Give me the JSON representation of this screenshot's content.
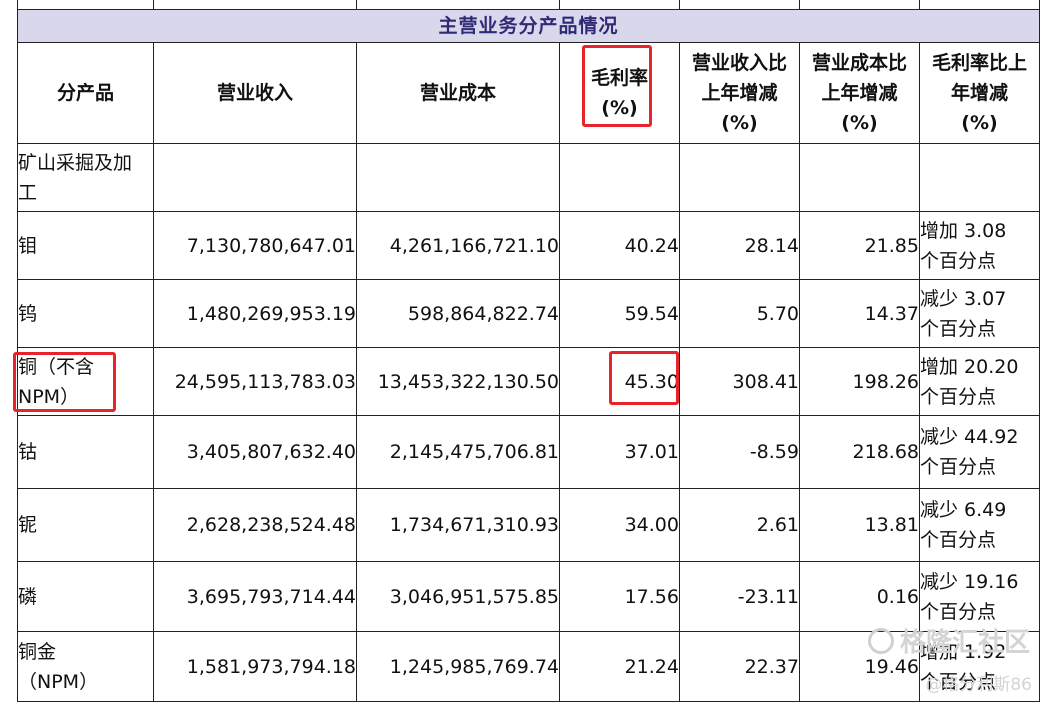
{
  "table": {
    "title": "主营业务分产品情况",
    "headers": {
      "product": "分产品",
      "revenue": "营业收入",
      "cost": "营业成本",
      "margin": [
        "毛利率",
        "(%)"
      ],
      "revenue_change": [
        "营业收入比",
        "上年增减",
        "(%)"
      ],
      "cost_change": [
        "营业成本比",
        "上年增减",
        "(%)"
      ],
      "margin_change": [
        "毛利率比上",
        "年增减",
        "(%)"
      ]
    },
    "section": [
      "矿山采掘及加",
      "工"
    ],
    "rows": [
      {
        "name": [
          "钼"
        ],
        "revenue": "7,130,780,647.01",
        "cost": "4,261,166,721.10",
        "margin": "40.24",
        "revenue_change": "28.14",
        "cost_change": "21.85",
        "margin_change": [
          "增加 3.08",
          "个百分点"
        ]
      },
      {
        "name": [
          "钨"
        ],
        "revenue": "1,480,269,953.19",
        "cost": "598,864,822.74",
        "margin": "59.54",
        "revenue_change": "5.70",
        "cost_change": "14.37",
        "margin_change": [
          "减少 3.07",
          "个百分点"
        ]
      },
      {
        "name": [
          "铜（不含",
          "NPM）"
        ],
        "revenue": "24,595,113,783.03",
        "cost": "13,453,322,130.50",
        "margin": "45.30",
        "revenue_change": "308.41",
        "cost_change": "198.26",
        "margin_change": [
          "增加 20.20",
          "个百分点"
        ]
      },
      {
        "name": [
          "钴"
        ],
        "revenue": "3,405,807,632.40",
        "cost": "2,145,475,706.81",
        "margin": "37.01",
        "revenue_change": "-8.59",
        "cost_change": "218.68",
        "margin_change": [
          "减少 44.92",
          "个百分点"
        ]
      },
      {
        "name": [
          "铌"
        ],
        "revenue": "2,628,238,524.48",
        "cost": "1,734,671,310.93",
        "margin": "34.00",
        "revenue_change": "2.61",
        "cost_change": "13.81",
        "margin_change": [
          "减少 6.49",
          "个百分点"
        ]
      },
      {
        "name": [
          "磷"
        ],
        "revenue": "3,695,793,714.44",
        "cost": "3,046,951,575.85",
        "margin": "17.56",
        "revenue_change": "-23.11",
        "cost_change": "0.16",
        "margin_change": [
          "减少 19.16",
          "个百分点"
        ]
      },
      {
        "name": [
          "铜金",
          "（NPM）"
        ],
        "revenue": "1,581,973,794.18",
        "cost": "1,245,985,769.74",
        "margin": "21.24",
        "revenue_change": "22.37",
        "cost_change": "19.46",
        "margin_change": [
          "增加 1.92",
          "个百分点"
        ]
      }
    ]
  },
  "highlight_color": "#e8232a",
  "title_band_color": "#d9d7ec",
  "title_text_color": "#2e2a73",
  "watermark": {
    "logo_text": "格隆汇社区",
    "user_text": "@格分利斯86"
  }
}
